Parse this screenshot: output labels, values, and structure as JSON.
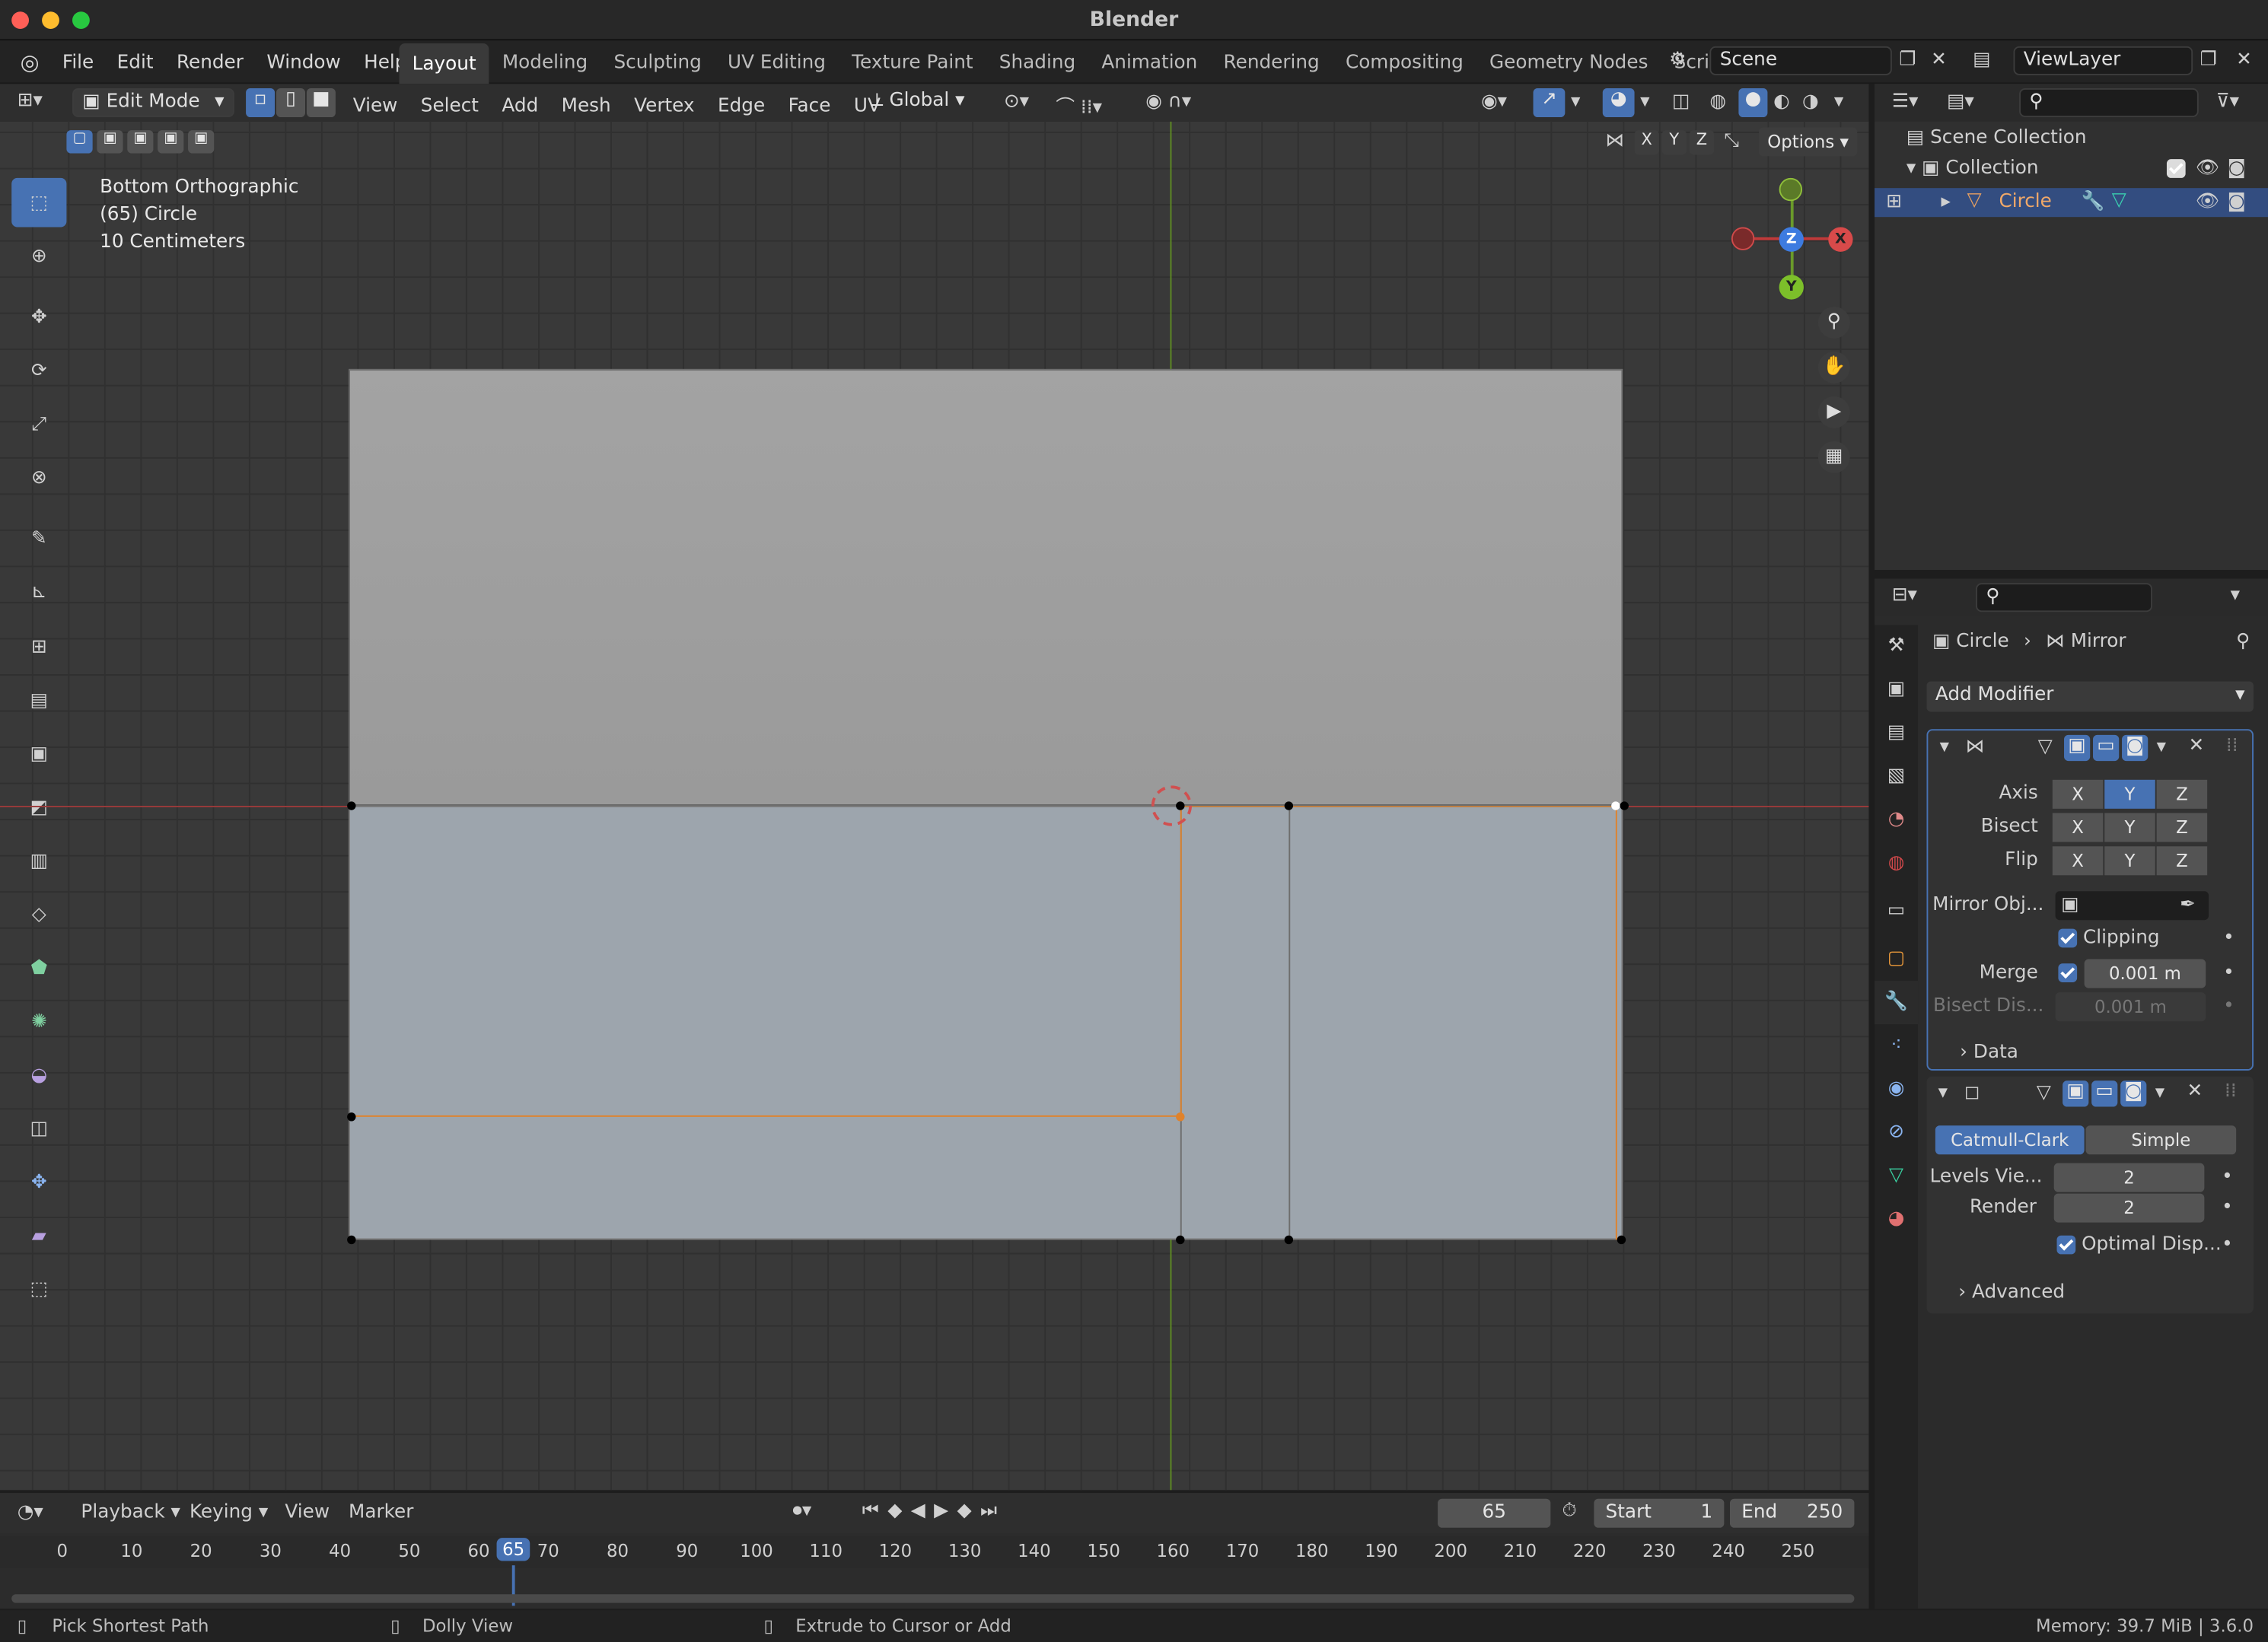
{
  "window": {
    "title": "Blender"
  },
  "menu": [
    "File",
    "Edit",
    "Render",
    "Window",
    "Help"
  ],
  "workspaces": [
    "Layout",
    "Modeling",
    "Sculpting",
    "UV Editing",
    "Texture Paint",
    "Shading",
    "Animation",
    "Rendering",
    "Compositing",
    "Geometry Nodes",
    "Scripting"
  ],
  "scene": {
    "value": "Scene"
  },
  "view_layer": {
    "value": "ViewLayer"
  },
  "header": {
    "mode": "Edit Mode",
    "menus": [
      "View",
      "Select",
      "Add",
      "Mesh",
      "Vertex",
      "Edge",
      "Face",
      "UV"
    ],
    "orientation": "Global",
    "options": "Options",
    "axes": [
      "X",
      "Y",
      "Z"
    ]
  },
  "viewport": {
    "line1": "Bottom Orthographic",
    "line2": "(65) Circle",
    "line3": "10 Centimeters"
  },
  "gizmo": {
    "z": "Z",
    "x": "X",
    "y": "Y"
  },
  "outliner": {
    "scene_collection": "Scene Collection",
    "collection": "Collection",
    "object": "Circle"
  },
  "properties": {
    "breadcrumb_object": "Circle",
    "breadcrumb_modifier": "Mirror",
    "add_modifier": "Add Modifier",
    "mirror": {
      "axis_label": "Axis",
      "bisect_label": "Bisect",
      "flip_label": "Flip",
      "axes": [
        "X",
        "Y",
        "Z"
      ],
      "mirror_object_label": "Mirror Obj...",
      "clipping_label": "Clipping",
      "merge_label": "Merge",
      "merge_value": "0.001 m",
      "bisect_dist_label": "Bisect Dis...",
      "bisect_dist_value": "0.001 m",
      "data_label": "Data"
    },
    "subsurf": {
      "catmull": "Catmull-Clark",
      "simple": "Simple",
      "levels_label": "Levels Vie...",
      "levels_value": "2",
      "render_label": "Render",
      "render_value": "2",
      "optimal_label": "Optimal Disp...",
      "advanced_label": "Advanced"
    }
  },
  "timeline": {
    "menus": [
      "Playback",
      "Keying",
      "View",
      "Marker"
    ],
    "current_frame": "65",
    "start_label": "Start",
    "start_value": "1",
    "end_label": "End",
    "end_value": "250",
    "ticks": [
      "0",
      "10",
      "20",
      "30",
      "40",
      "50",
      "60",
      "70",
      "80",
      "90",
      "100",
      "110",
      "120",
      "130",
      "140",
      "150",
      "160",
      "170",
      "180",
      "190",
      "200",
      "210",
      "220",
      "230",
      "240",
      "250"
    ]
  },
  "status": {
    "left": "Pick Shortest Path",
    "middle": "Dolly View",
    "right_action": "Extrude to Cursor or Add",
    "memory": "Memory: 39.7 MiB | 3.6.0"
  }
}
